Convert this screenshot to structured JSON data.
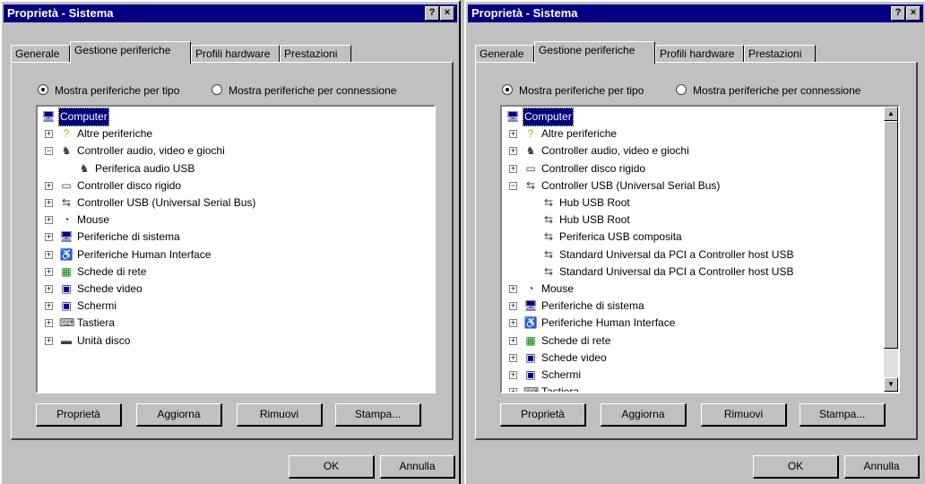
{
  "left": {
    "title": "Proprietà - Sistema",
    "help_glyph": "?",
    "close_glyph": "×",
    "tabs": [
      "Generale",
      "Gestione periferiche",
      "Profili hardware",
      "Prestazioni"
    ],
    "radio_by_type": "Mostra periferiche per tipo",
    "radio_by_connection": "Mostra periferiche per connessione",
    "tree": [
      {
        "label": "Computer",
        "icon": "computer-icon",
        "selected": true
      },
      {
        "label": "Altre periferiche",
        "icon": "question-icon"
      },
      {
        "label": "Controller audio, video e giochi",
        "icon": "joystick-icon"
      },
      {
        "label": "Periferica audio USB",
        "icon": "joystick-icon"
      },
      {
        "label": "Controller disco rigido",
        "icon": "drive-icon"
      },
      {
        "label": "Controller USB (Universal Serial Bus)",
        "icon": "usb-icon"
      },
      {
        "label": "Mouse",
        "icon": "mouse-icon"
      },
      {
        "label": "Periferiche di sistema",
        "icon": "computer-icon"
      },
      {
        "label": "Periferiche Human Interface",
        "icon": "hid-icon"
      },
      {
        "label": "Schede di rete",
        "icon": "network-card-icon"
      },
      {
        "label": "Schede video",
        "icon": "monitor-icon"
      },
      {
        "label": "Schermi",
        "icon": "monitor-icon"
      },
      {
        "label": "Tastiera",
        "icon": "keyboard-icon"
      },
      {
        "label": "Unità disco",
        "icon": "disk-icon"
      }
    ],
    "buttons": [
      "Proprietà",
      "Aggiorna",
      "Rimuovi",
      "Stampa..."
    ],
    "ok": "OK",
    "cancel": "Annulla"
  },
  "right": {
    "title": "Proprietà - Sistema",
    "help_glyph": "?",
    "close_glyph": "×",
    "tabs": [
      "Generale",
      "Gestione periferiche",
      "Profili hardware",
      "Prestazioni"
    ],
    "radio_by_type": "Mostra periferiche per tipo",
    "radio_by_connection": "Mostra periferiche per connessione",
    "tree": [
      {
        "label": "Computer",
        "icon": "computer-icon",
        "selected": true
      },
      {
        "label": "Altre periferiche",
        "icon": "question-icon"
      },
      {
        "label": "Controller audio, video e giochi",
        "icon": "joystick-icon"
      },
      {
        "label": "Controller disco rigido",
        "icon": "drive-icon"
      },
      {
        "label": "Controller USB (Universal Serial Bus)",
        "icon": "usb-icon"
      },
      {
        "label": "Hub USB Root",
        "icon": "usb-icon"
      },
      {
        "label": "Hub USB Root",
        "icon": "usb-icon"
      },
      {
        "label": "Periferica USB composita",
        "icon": "usb-icon"
      },
      {
        "label": "Standard Universal da PCI a Controller host USB",
        "icon": "usb-icon"
      },
      {
        "label": "Standard Universal da PCI a Controller host USB",
        "icon": "usb-icon"
      },
      {
        "label": "Mouse",
        "icon": "mouse-icon"
      },
      {
        "label": "Periferiche di sistema",
        "icon": "computer-icon"
      },
      {
        "label": "Periferiche Human Interface",
        "icon": "hid-icon"
      },
      {
        "label": "Schede di rete",
        "icon": "network-card-icon"
      },
      {
        "label": "Schede video",
        "icon": "monitor-icon"
      },
      {
        "label": "Schermi",
        "icon": "monitor-icon"
      },
      {
        "label": "Tastiera",
        "icon": "keyboard-icon"
      }
    ],
    "buttons": [
      "Proprietà",
      "Aggiorna",
      "Rimuovi",
      "Stampa..."
    ],
    "ok": "OK",
    "cancel": "Annulla"
  }
}
